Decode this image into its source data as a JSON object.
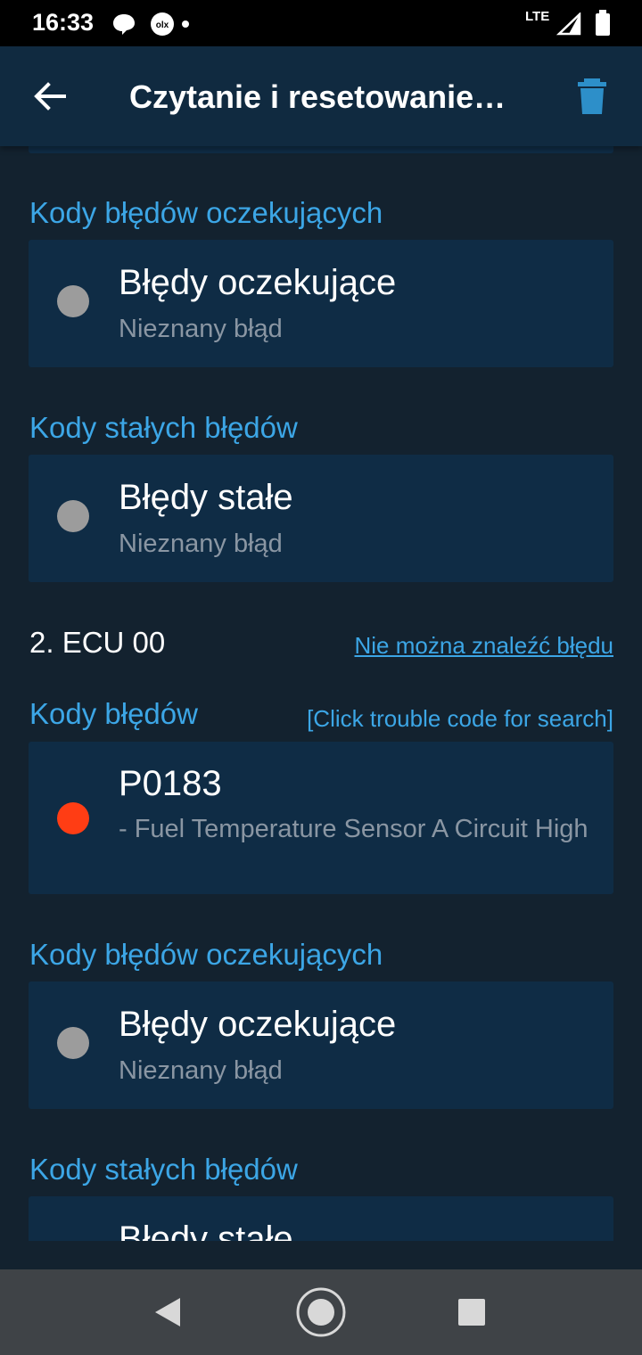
{
  "status_bar": {
    "time": "16:33",
    "network": "LTE",
    "icons": [
      "chat-bubble-icon",
      "olx-icon",
      "notification-dot-icon",
      "signal-icon",
      "battery-icon"
    ]
  },
  "app_bar": {
    "title": "Czytanie i resetowanie…",
    "back_icon": "arrow-left-icon",
    "delete_icon": "trash-icon"
  },
  "content": {
    "ecu1_pending_header": "Kody błędów oczekujących",
    "ecu1_pending_card": {
      "title": "Błędy oczekujące",
      "subtitle": "Nieznany błąd",
      "status": "gray"
    },
    "ecu1_permanent_header": "Kody stałych błędów",
    "ecu1_permanent_card": {
      "title": "Błędy stałe",
      "subtitle": "Nieznany błąd",
      "status": "gray"
    },
    "ecu2": {
      "title": "2. ECU 00",
      "link": "Nie można znaleźć błędu",
      "codes_header": "Kody błędów",
      "codes_hint": "[Click trouble code for search]",
      "code_card": {
        "code": "P0183",
        "description": " - Fuel Temperature Sensor A Circuit High",
        "status": "red"
      },
      "pending_header": "Kody błędów oczekujących",
      "pending_card": {
        "title": "Błędy oczekujące",
        "subtitle": "Nieznany błąd",
        "status": "gray"
      },
      "permanent_header": "Kody stałych błędów",
      "permanent_card": {
        "title": "Błędy stałe"
      }
    }
  },
  "nav_bar": {
    "buttons": [
      "nav-back-icon",
      "nav-home-icon",
      "nav-recents-icon"
    ]
  },
  "colors": {
    "background": "#13222f",
    "card": "#0f2c45",
    "app_bar": "#102a40",
    "accent": "#3ca6e6",
    "error": "#ff3d14",
    "inactive": "#9c9c9c"
  }
}
